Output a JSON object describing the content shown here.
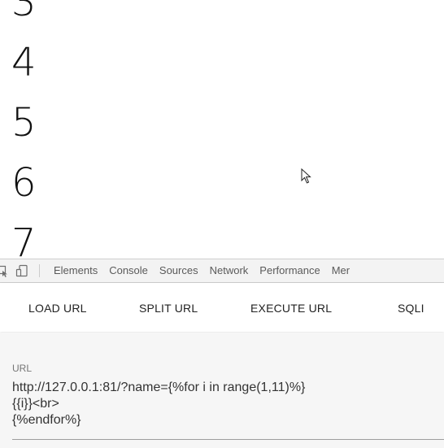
{
  "viewport": {
    "numbers": [
      "3",
      "4",
      "5",
      "6",
      "7"
    ]
  },
  "devtools": {
    "tabs": [
      "Elements",
      "Console",
      "Sources",
      "Network",
      "Performance",
      "Mer"
    ]
  },
  "extension_toolbar": {
    "load_url_label": "LOAD URL",
    "split_url_label": "SPLIT URL",
    "execute_url_label": "EXECUTE URL",
    "sqli_label": "SQLI"
  },
  "url_panel": {
    "label": "URL",
    "value": "http://127.0.0.1:81/?name={%for i in range(1,11)%}\n{{i}}<br>\n{%endfor%}"
  }
}
